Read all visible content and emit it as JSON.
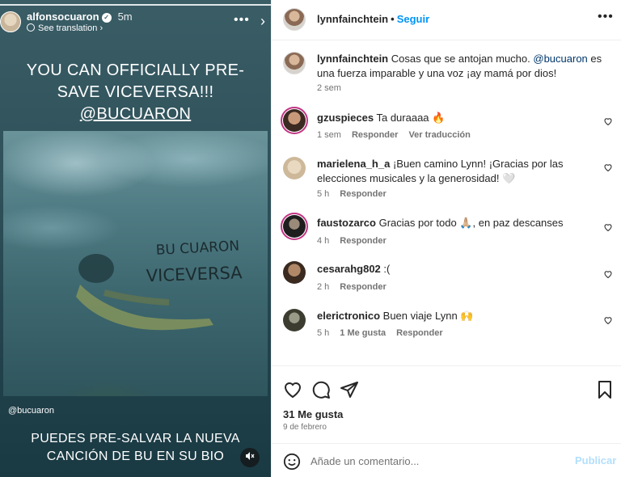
{
  "story": {
    "username": "alfonsocuaron",
    "time": "5m",
    "see_translation": "See translation",
    "more": "•••",
    "next": "›",
    "headline_line1": "YOU CAN OFFICIALLY PRE-",
    "headline_line2": "SAVE VICEVERSA!!!",
    "headline_mention": "@BUCUARON",
    "handwriting_line1": "BU CUARON",
    "handwriting_line2": "VICEVERSA",
    "credit": "@bucuaron",
    "footer_line1": "PUEDES PRE-SALVAR LA NUEVA",
    "footer_line2": "CANCIÓN DE BU EN SU BIO",
    "mute_icon": "speaker-muted-icon"
  },
  "post": {
    "author": "lynnfainchtein",
    "follow_label": "Seguir",
    "more": "•••",
    "caption_text_1": "Cosas que se antojan mucho.",
    "caption_mention": "@bucuaron",
    "caption_text_2": "es una fuerza imparable y una voz ¡ay mamá por dios!",
    "caption_time": "2 sem"
  },
  "comments": [
    {
      "username": "gzuspieces",
      "text": "Ta duraaaa 🔥",
      "time": "1 sem",
      "reply": "Responder",
      "translate": "Ver traducción"
    },
    {
      "username": "marielena_h_a",
      "text": "¡Buen camino Lynn! ¡Gracias por las elecciones musicales y la generosidad! 🤍",
      "time": "5 h",
      "reply": "Responder"
    },
    {
      "username": "faustozarco",
      "text": "Gracias por todo 🙏🏼, en paz descanses",
      "time": "4 h",
      "reply": "Responder"
    },
    {
      "username": "cesarahg802",
      "text": ":(",
      "time": "2 h",
      "reply": "Responder"
    },
    {
      "username": "elerictronico",
      "text": "Buen viaje Lynn 🙌",
      "time": "5 h",
      "likes": "1 Me gusta",
      "reply": "Responder"
    }
  ],
  "actions": {
    "likes": "31 Me gusta",
    "date": "9 de febrero"
  },
  "comment_box": {
    "placeholder": "Añade un comentario...",
    "publish": "Publicar"
  }
}
